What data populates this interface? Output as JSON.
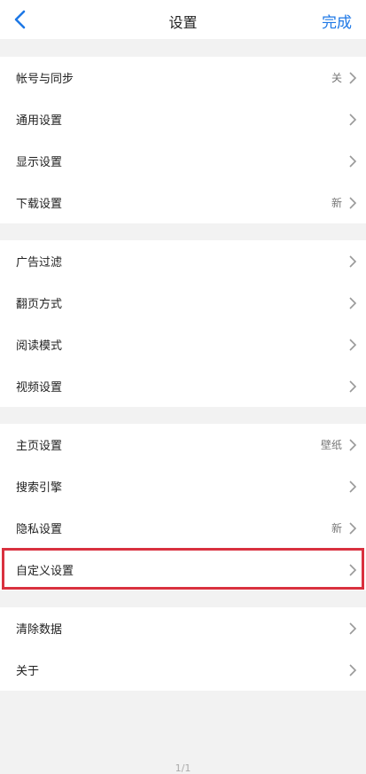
{
  "colors": {
    "accent": "#1e78e6",
    "highlight": "#d9313f"
  },
  "navbar": {
    "title": "设置",
    "done_label": "完成",
    "back_icon": "chevron-left-icon"
  },
  "groups": [
    {
      "items": [
        {
          "label": "帐号与同步",
          "value": "关"
        },
        {
          "label": "通用设置",
          "value": ""
        },
        {
          "label": "显示设置",
          "value": ""
        },
        {
          "label": "下载设置",
          "value": "新"
        }
      ]
    },
    {
      "items": [
        {
          "label": "广告过滤",
          "value": ""
        },
        {
          "label": "翻页方式",
          "value": ""
        },
        {
          "label": "阅读模式",
          "value": ""
        },
        {
          "label": "视频设置",
          "value": ""
        }
      ]
    },
    {
      "items": [
        {
          "label": "主页设置",
          "value": "壁纸"
        },
        {
          "label": "搜索引擎",
          "value": ""
        },
        {
          "label": "隐私设置",
          "value": "新"
        },
        {
          "label": "自定义设置",
          "value": ""
        }
      ]
    },
    {
      "items": [
        {
          "label": "清除数据",
          "value": ""
        },
        {
          "label": "关于",
          "value": ""
        }
      ]
    }
  ],
  "footer": {
    "page_indicator": "1/1"
  }
}
